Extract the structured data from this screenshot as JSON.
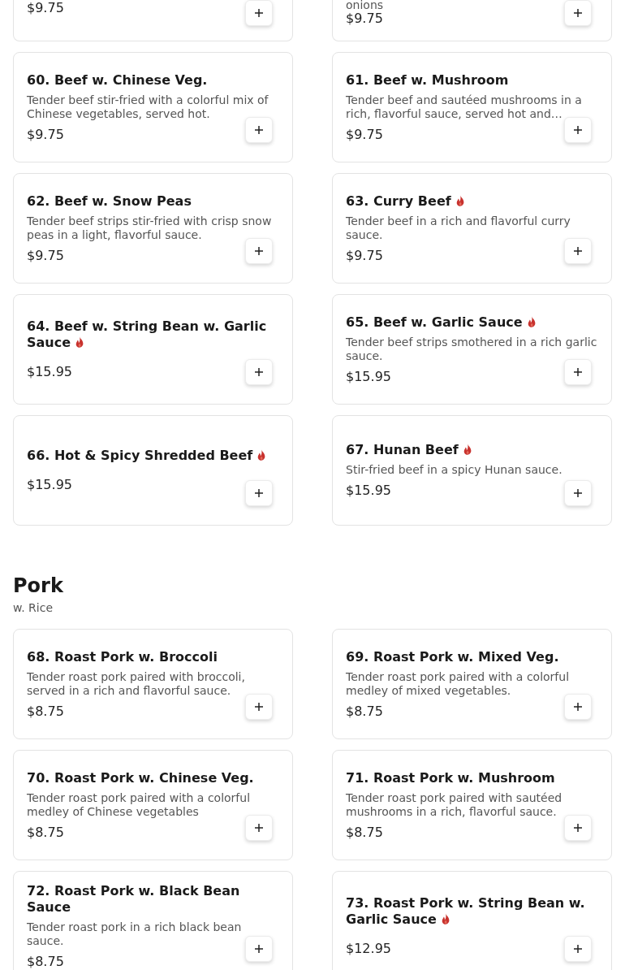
{
  "menu_sections": [
    {
      "items": [
        {
          "kind": "partial",
          "price": "$9.75"
        },
        {
          "kind": "partial",
          "description": "onions",
          "price": "$9.75"
        },
        {
          "kind": "full",
          "name": "60. Beef w. Chinese Veg.",
          "spicy": false,
          "description": "Tender beef stir-fried with a colorful mix of Chinese vegetables, served hot.",
          "price": "$9.75"
        },
        {
          "kind": "full",
          "name": "61. Beef w. Mushroom",
          "spicy": false,
          "description": "Tender beef and sautéed mushrooms in a rich, flavorful sauce, served hot and…",
          "price": "$9.75"
        },
        {
          "kind": "full",
          "name": "62. Beef w. Snow Peas",
          "spicy": false,
          "description": "Tender beef strips stir-fried with crisp snow peas in a light, flavorful sauce.",
          "price": "$9.75"
        },
        {
          "kind": "full",
          "name": "63. Curry Beef",
          "spicy": true,
          "description": "Tender beef in a rich and flavorful curry sauce.",
          "price": "$9.75"
        },
        {
          "kind": "full",
          "name": "64. Beef w. String Bean w. Garlic Sauce",
          "spicy": true,
          "price": "$15.95"
        },
        {
          "kind": "full",
          "name": "65. Beef w. Garlic Sauce",
          "spicy": true,
          "description": "Tender beef strips smothered in a rich garlic sauce.",
          "price": "$15.95"
        },
        {
          "kind": "full",
          "name": "66. Hot & Spicy Shredded Beef",
          "spicy": true,
          "price": "$15.95"
        },
        {
          "kind": "full",
          "name": "67. Hunan Beef",
          "spicy": true,
          "description": "Stir-fried beef in a spicy Hunan sauce.",
          "price": "$15.95"
        }
      ]
    },
    {
      "title": "Pork",
      "subtitle": "w. Rice",
      "items": [
        {
          "name": "68. Roast Pork w. Broccoli",
          "spicy": false,
          "description": "Tender roast pork paired with broccoli, served in a rich and flavorful sauce.",
          "price": "$8.75"
        },
        {
          "name": "69. Roast Pork w. Mixed Veg.",
          "spicy": false,
          "description": "Tender roast pork paired with a colorful medley of mixed vegetables.",
          "price": "$8.75"
        },
        {
          "name": "70. Roast Pork w. Chinese Veg.",
          "spicy": false,
          "description": "Tender roast pork paired with a colorful medley of Chinese vegetables",
          "price": "$8.75"
        },
        {
          "name": "71. Roast Pork w. Mushroom",
          "spicy": false,
          "description": "Tender roast pork paired with sautéed mushrooms in a rich, flavorful sauce.",
          "price": "$8.75"
        },
        {
          "name": "72. Roast Pork w. Black Bean Sauce",
          "spicy": false,
          "description": "Tender roast pork in a rich black bean sauce.",
          "price": "$8.75"
        },
        {
          "name": "73. Roast Pork w. String Bean w. Garlic Sauce",
          "spicy": true,
          "price": "$12.95"
        }
      ]
    }
  ]
}
